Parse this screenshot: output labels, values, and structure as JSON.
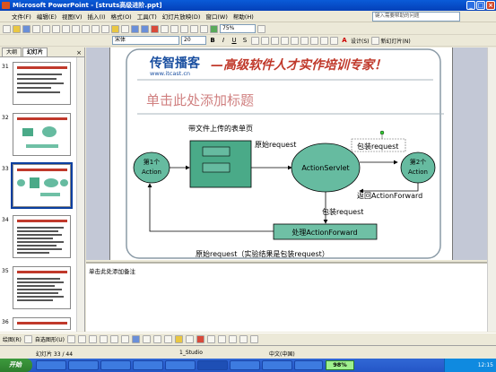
{
  "window": {
    "title": "Microsoft PowerPoint - [struts高级进阶.ppt]",
    "help_placeholder": "键入需要帮助的问题"
  },
  "menu": [
    "文件(F)",
    "编辑(E)",
    "视图(V)",
    "插入(I)",
    "格式(O)",
    "工具(T)",
    "幻灯片放映(D)",
    "窗口(W)",
    "帮助(H)"
  ],
  "toolbar": {
    "font_name": "宋体",
    "font_size": "20",
    "bold": "B",
    "italic": "I",
    "underline": "U",
    "shadow": "S",
    "font_color_label": "A",
    "design_label": "设计(S)",
    "new_slide_label": "新幻灯片(N)",
    "zoom": "75%"
  },
  "left_pane": {
    "tabs": [
      "大纲",
      "幻灯片"
    ],
    "thumbnails": [
      "31",
      "32",
      "33",
      "34",
      "35",
      "36"
    ],
    "selected": "33"
  },
  "slide": {
    "brand_name": "传智播客",
    "brand_url": "www.itcast.cn",
    "slogan": "—高级软件人才实作培训专家！",
    "title_placeholder": "单击此处添加标题",
    "diagram": {
      "form_caption": "带文件上传的表单页",
      "orig_request_top": "原始request",
      "wrapped_request_top": "包装request",
      "action1": [
        "第1个",
        "Action"
      ],
      "servlet": "ActionServlet",
      "action2": [
        "第2个",
        "Action"
      ],
      "return_forward": "返回ActionForward",
      "wrapped_request_mid": "包装request",
      "process_forward": "处理ActionForward",
      "bottom_note": "原始request（实验结果是包装request）"
    }
  },
  "notes": {
    "placeholder": "单击此处添加备注"
  },
  "drawbar": {
    "draw_label": "绘图(R)",
    "autoshapes_label": "自选图形(U)"
  },
  "status": {
    "slide_count": "幻灯片 33 / 44",
    "design": "1_Studio",
    "language": "中文(中国)"
  },
  "taskbar": {
    "start": "开始",
    "items": [
      "",
      "",
      "",
      "",
      "",
      "",
      "",
      "",
      ""
    ],
    "zoom_indicator": "98%",
    "time": "12:15"
  },
  "colors": {
    "titlebar": "#0a4fd0",
    "slogan": "#c0392b",
    "slide_title": "#c0392b",
    "box_fill": "#4aaa88",
    "ellipse_fill": "#66bba0",
    "process_fill": "#6fc0a5"
  }
}
